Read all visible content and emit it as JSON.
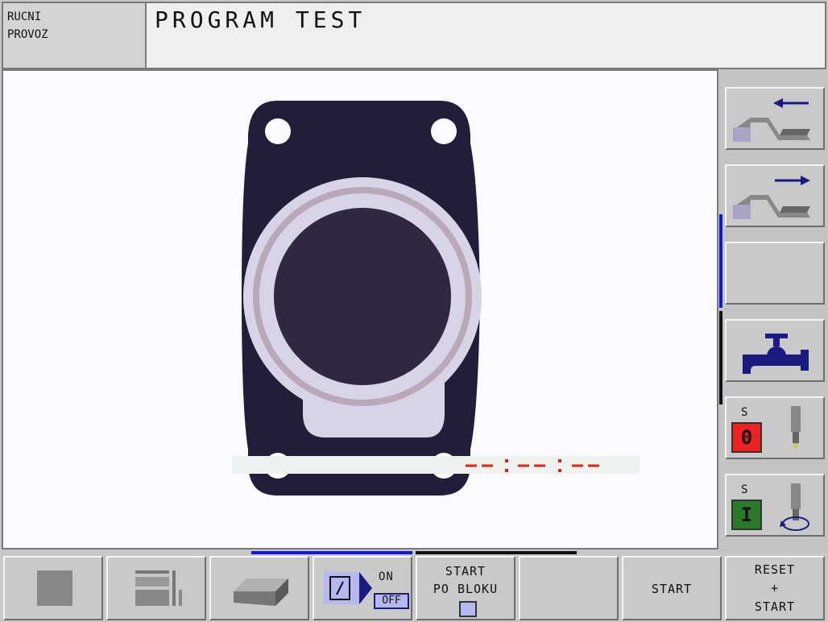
{
  "header": {
    "mode_line1": "RUCNI",
    "mode_line2": "PROVOZ",
    "title": "PROGRAM TEST"
  },
  "right_softkeys": [
    {
      "name": "page-left",
      "icon": "machine-arrow-left-icon"
    },
    {
      "name": "page-right",
      "icon": "machine-arrow-right-icon"
    },
    {
      "name": "empty",
      "icon": ""
    },
    {
      "name": "coolant",
      "icon": "faucet-icon"
    },
    {
      "name": "spindle-off",
      "label": "S",
      "value": "0",
      "icon": "spindle-icon",
      "color": "#ee2222"
    },
    {
      "name": "spindle-on",
      "label": "S",
      "value": "I",
      "icon": "spindle-rotate-icon",
      "color": "#2a7a2a"
    }
  ],
  "bottom_softkeys": {
    "stop": {
      "icon": "stop-square-icon"
    },
    "view": {
      "icon": "window-layout-icon"
    },
    "workpiece": {
      "icon": "workpiece-block-icon"
    },
    "block_skip": {
      "icon": "block-skip-icon",
      "on_label": "ON",
      "off_label": "OFF"
    },
    "start_block": {
      "line1": "START",
      "line2": "PO BLOKU"
    },
    "empty": {},
    "start": {
      "label": "START"
    },
    "reset_start": {
      "line1": "RESET",
      "line2": "+",
      "line3": "START"
    }
  },
  "colors": {
    "part_dark": "#221e3a",
    "part_ring": "#d8d4e8",
    "part_groove": "#b8a8b8",
    "pocket": "#302840",
    "accent_blue": "#1515e0",
    "red_scale": "#dd2222"
  }
}
